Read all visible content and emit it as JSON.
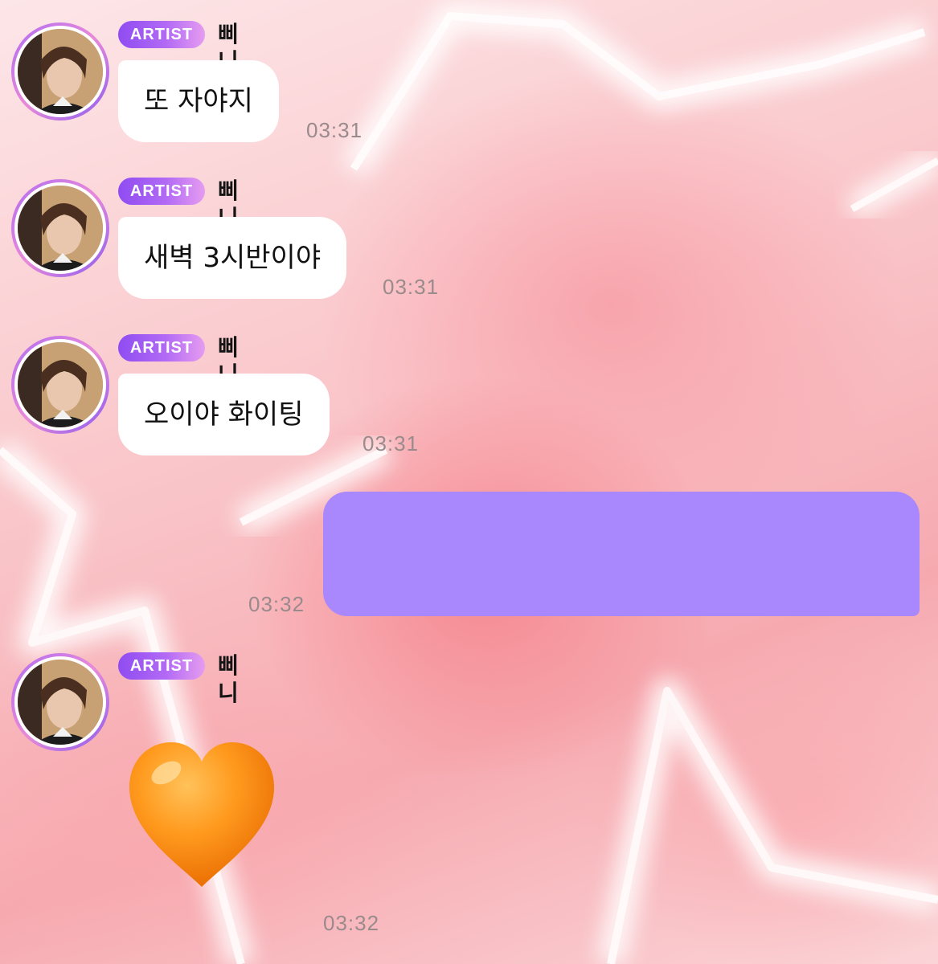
{
  "messages": [
    {
      "badge": "ARTIST",
      "name": "삐니",
      "text": "또 자야지",
      "time": "03:31"
    },
    {
      "badge": "ARTIST",
      "name": "삐니",
      "text": "새벽 3시반이야",
      "time": "03:31"
    },
    {
      "badge": "ARTIST",
      "name": "삐니",
      "text": "오이야 화이팅",
      "time": "03:31"
    }
  ],
  "my_message": {
    "time": "03:32",
    "bubble_color": "#a987fc"
  },
  "last_message": {
    "badge": "ARTIST",
    "name": "삐니",
    "emoji": "orange-heart",
    "time": "03:32"
  },
  "colors": {
    "badge_start": "#8f4cf1",
    "badge_end": "#e59cf0",
    "bubble": "#ffffff",
    "my_bubble": "#a987fc",
    "timestamp": "#9a8a8c"
  }
}
